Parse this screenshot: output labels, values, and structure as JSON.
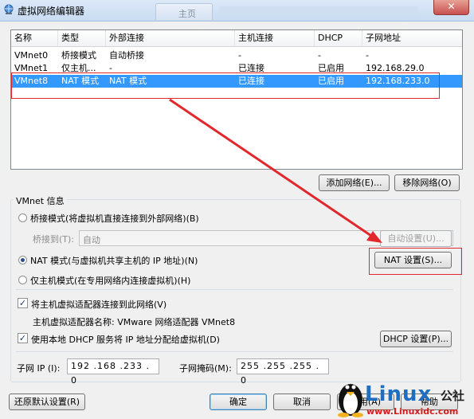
{
  "window": {
    "title": "虚拟网络编辑器",
    "close_glyph": "✕",
    "ghost_tab_label": "主页"
  },
  "table": {
    "columns": [
      "名称",
      "类型",
      "外部连接",
      "主机连接",
      "DHCP",
      "子网地址"
    ],
    "rows": [
      {
        "name": "VMnet0",
        "type": "桥接模式",
        "external": "自动桥接",
        "host": "-",
        "dhcp": "-",
        "subnet": "-"
      },
      {
        "name": "VMnet1",
        "type": "仅主机...",
        "external": "-",
        "host": "已连接",
        "dhcp": "已启用",
        "subnet": "192.168.29.0"
      },
      {
        "name": "VMnet8",
        "type": "NAT 模式",
        "external": "NAT 模式",
        "host": "已连接",
        "dhcp": "已启用",
        "subnet": "192.168.233.0"
      }
    ],
    "selected_index": 2
  },
  "buttons": {
    "add_network": "添加网络(E)...",
    "remove_network": "移除网络(O)",
    "auto_settings": "自动设置(U)...",
    "nat_settings": "NAT 设置(S)...",
    "dhcp_settings": "DHCP 设置(P)...",
    "restore_defaults": "还原默认设置(R)",
    "ok": "确定",
    "cancel": "取消",
    "apply": "应用(A)",
    "help": "帮助"
  },
  "vmnet_info": {
    "group_label": "VMnet 信息",
    "bridge_label": "桥接模式(将虚拟机直接连接到外部网络)(B)",
    "bridge_to_label": "桥接到(T):",
    "bridge_to_value": "自动",
    "nat_label": "NAT 模式(与虚拟机共享主机的 IP 地址)(N)",
    "hostonly_label": "仅主机模式(在专用网络内连接虚拟机)(H)",
    "mode_selected": "nat",
    "connect_adapter_label": "将主机虚拟适配器连接到此网络(V)",
    "connect_adapter_checked": true,
    "adapter_name_label": "主机虚拟适配器名称: VMware 网络适配器 VMnet8",
    "use_dhcp_label": "使用本地 DHCP 服务将 IP 地址分配给虚拟机(D)",
    "use_dhcp_checked": true,
    "subnet_ip_label": "子网 IP (I):",
    "subnet_ip_value": "192 .168 .233 . 0",
    "subnet_mask_label": "子网掩码(M):",
    "subnet_mask_value": "255 .255 .255 . 0"
  },
  "watermark": {
    "logo_text": "Linux",
    "logo_cn": "公社",
    "url": "www.Linuxidc.com"
  },
  "colors": {
    "selection": "#3399ff",
    "annotation_red": "#e0282d",
    "logo_blue": "#1e6fc0"
  },
  "icons": {
    "app": "network-globe-icon",
    "check_mark": "✓",
    "dropdown": "▼"
  }
}
